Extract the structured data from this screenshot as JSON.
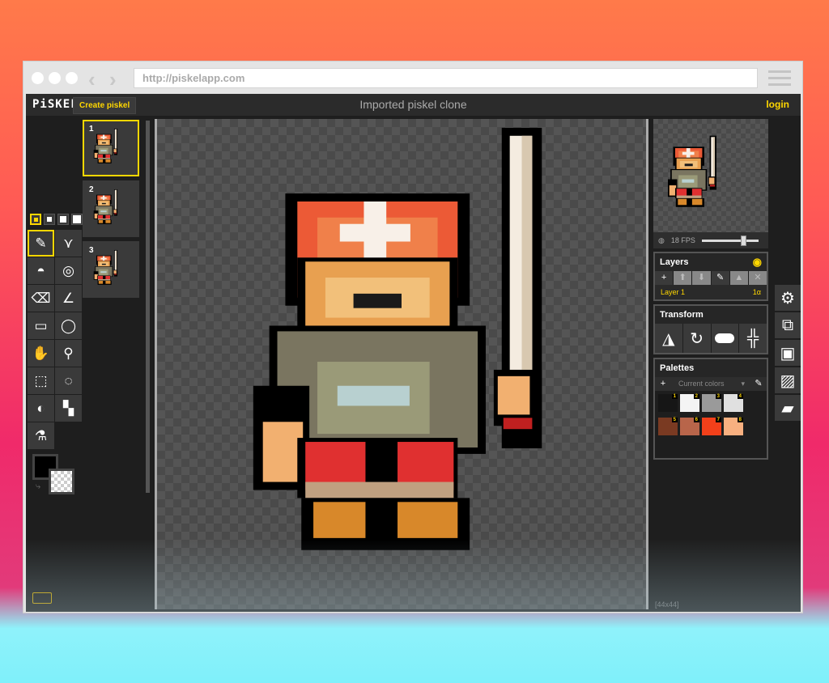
{
  "browser": {
    "url": "http://piskelapp.com",
    "back": "‹",
    "forward": "›"
  },
  "header": {
    "logo": "PiSKEL",
    "create_label": "Create piskel",
    "title": "Imported piskel clone",
    "login_label": "login"
  },
  "tools": [
    {
      "name": "pen",
      "icon": "✎"
    },
    {
      "name": "vertical-mirror-pen",
      "icon": "⋎"
    },
    {
      "name": "paint-bucket",
      "icon": "◓"
    },
    {
      "name": "paint-all-same-color",
      "icon": "◎"
    },
    {
      "name": "eraser",
      "icon": "⌫"
    },
    {
      "name": "stroke",
      "icon": "∠"
    },
    {
      "name": "rectangle",
      "icon": "▭"
    },
    {
      "name": "circle",
      "icon": "◯"
    },
    {
      "name": "move",
      "icon": "✋"
    },
    {
      "name": "magic-wand",
      "icon": "⚲"
    },
    {
      "name": "rectangle-select",
      "icon": "⬚"
    },
    {
      "name": "lasso-select",
      "icon": "◌"
    },
    {
      "name": "lighten",
      "icon": "◐"
    },
    {
      "name": "dithering",
      "icon": "▚"
    },
    {
      "name": "color-picker",
      "icon": "⚗"
    }
  ],
  "frames": [
    {
      "number": "1"
    },
    {
      "number": "2"
    },
    {
      "number": "3"
    }
  ],
  "preview": {
    "fps_label": "18 FPS",
    "fps": 18
  },
  "layers": {
    "title": "Layers",
    "items": [
      {
        "name": "Layer 1",
        "opacity": "1α"
      }
    ]
  },
  "transform": {
    "title": "Transform"
  },
  "palettes": {
    "title": "Palettes",
    "selected": "Current colors",
    "colors": [
      {
        "n": "1",
        "hex": "#161616"
      },
      {
        "n": "2",
        "hex": "#f4f4f4"
      },
      {
        "n": "3",
        "hex": "#9a9a9a"
      },
      {
        "n": "4",
        "hex": "#e0e0e0"
      },
      {
        "n": "5",
        "hex": "#7a3a22"
      },
      {
        "n": "6",
        "hex": "#b8654a"
      },
      {
        "n": "7",
        "hex": "#f2401a"
      },
      {
        "n": "8",
        "hex": "#f8b080"
      }
    ]
  },
  "canvas": {
    "dimensions": "[44x44]"
  },
  "colors": {
    "accent": "#ffd700",
    "primary": "#000000",
    "secondary": "transparent"
  }
}
